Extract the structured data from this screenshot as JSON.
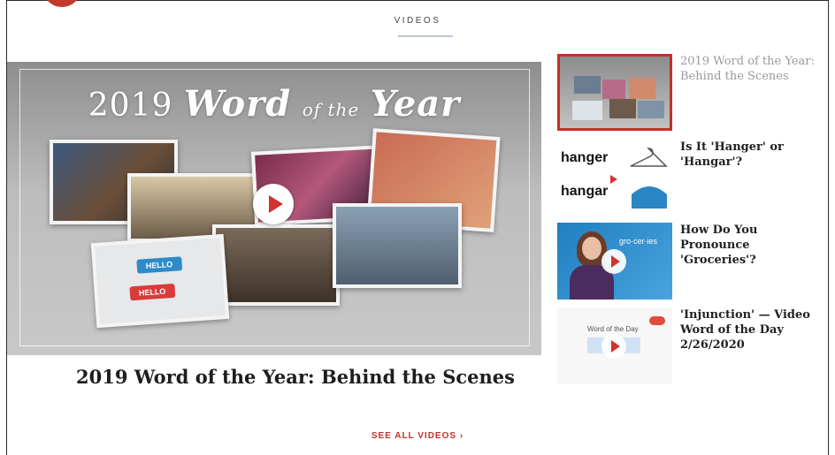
{
  "section": {
    "title": "VIDEOS"
  },
  "featured": {
    "heading_year": "2019",
    "heading_word": "Word",
    "heading_of": "of the",
    "heading_year_word": "Year",
    "badge_hello_1": "HELLO",
    "badge_hello_2": "HELLO",
    "caption": "2019 Word of the Year: Behind the Scenes"
  },
  "sidebar": {
    "items": [
      {
        "title": "2019 Word of the Year: Behind the Scenes",
        "active": true
      },
      {
        "title": "Is It 'Hanger' or 'Hangar'?",
        "thumb_top": "hanger",
        "thumb_bottom": "hangar"
      },
      {
        "title": "How Do You Pronounce 'Groceries'?",
        "thumb_text": "gro·cer·ies"
      },
      {
        "title": "'Injunction' — Video Word of the Day 2/26/2020",
        "thumb_text": "Word of the Day"
      }
    ]
  },
  "footer": {
    "see_all": "SEE ALL VIDEOS ›"
  },
  "colors": {
    "accent": "#c4302b",
    "active_border": "#c4302b"
  }
}
